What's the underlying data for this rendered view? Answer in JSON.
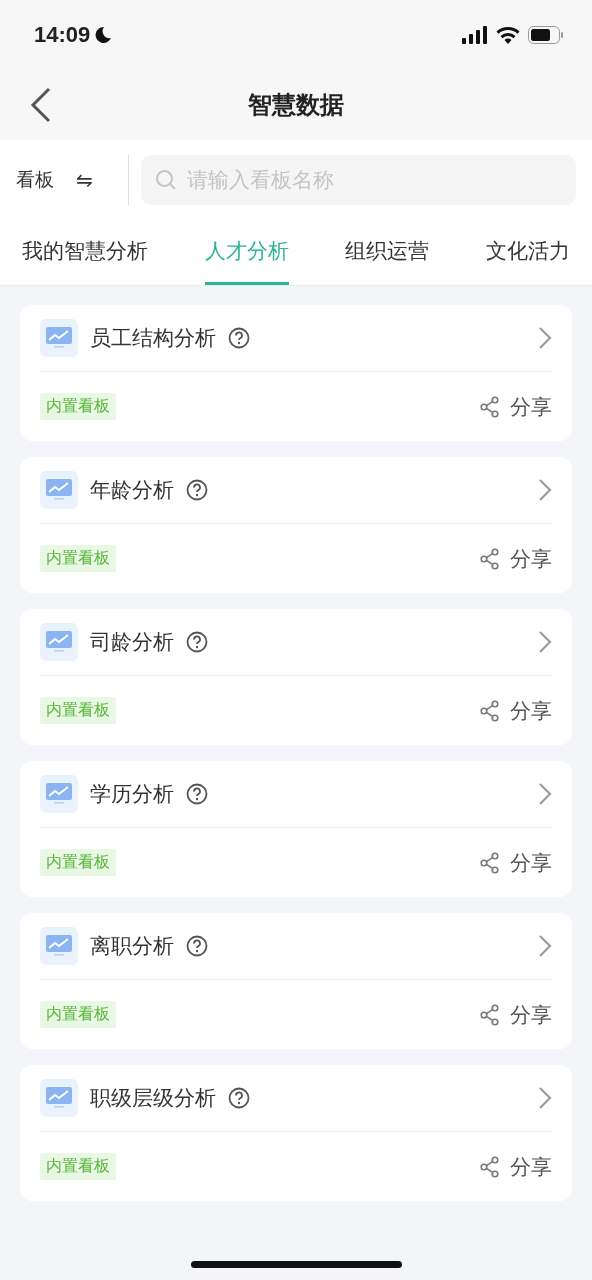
{
  "status_bar": {
    "time": "14:09"
  },
  "nav_bar": {
    "title": "智慧数据"
  },
  "filter": {
    "label": "看板",
    "swap": "⇋",
    "search": {
      "placeholder": "请输入看板名称"
    }
  },
  "tabs": [
    {
      "label": "我的智慧分析",
      "selected": false
    },
    {
      "label": "人才分析",
      "selected": true
    },
    {
      "label": "组织运营",
      "selected": false
    },
    {
      "label": "文化活力",
      "selected": false
    }
  ],
  "cards": [
    {
      "title": "员工结构分析",
      "tag": "内置看板",
      "share": "分享"
    },
    {
      "title": "年龄分析",
      "tag": "内置看板",
      "share": "分享"
    },
    {
      "title": "司龄分析",
      "tag": "内置看板",
      "share": "分享"
    },
    {
      "title": "学历分析",
      "tag": "内置看板",
      "share": "分享"
    },
    {
      "title": "离职分析",
      "tag": "内置看板",
      "share": "分享"
    },
    {
      "title": "职级层级分析",
      "tag": "内置看板",
      "share": "分享"
    }
  ]
}
